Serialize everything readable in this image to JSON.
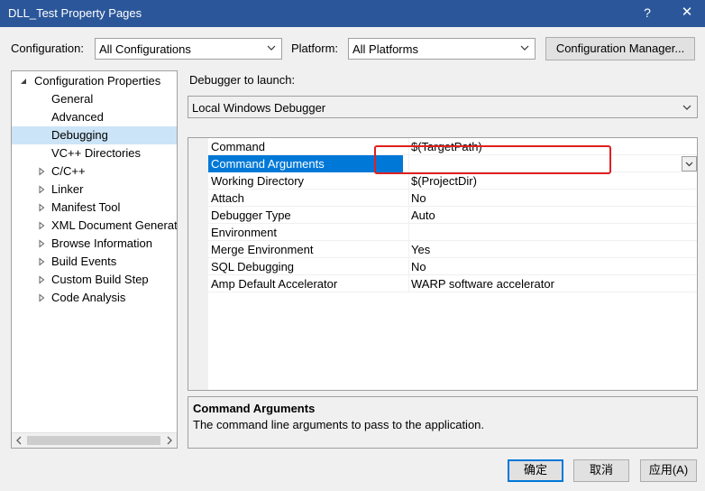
{
  "window": {
    "title": "DLL_Test Property Pages",
    "help": "?",
    "close": "✕"
  },
  "config": {
    "label": "Configuration:",
    "value": "All Configurations",
    "platform_label": "Platform:",
    "platform_value": "All Platforms",
    "manager_button": "Configuration Manager..."
  },
  "tree": {
    "items": [
      {
        "label": "Configuration Properties",
        "expander": "expanded"
      },
      {
        "label": "General",
        "expander": "none"
      },
      {
        "label": "Advanced",
        "expander": "none"
      },
      {
        "label": "Debugging",
        "expander": "none",
        "selected": true
      },
      {
        "label": "VC++ Directories",
        "expander": "none"
      },
      {
        "label": "C/C++",
        "expander": "collapsed"
      },
      {
        "label": "Linker",
        "expander": "collapsed"
      },
      {
        "label": "Manifest Tool",
        "expander": "collapsed"
      },
      {
        "label": "XML Document Generat",
        "expander": "collapsed"
      },
      {
        "label": "Browse Information",
        "expander": "collapsed"
      },
      {
        "label": "Build Events",
        "expander": "collapsed"
      },
      {
        "label": "Custom Build Step",
        "expander": "collapsed"
      },
      {
        "label": "Code Analysis",
        "expander": "collapsed"
      }
    ]
  },
  "debugger": {
    "label": "Debugger to launch:",
    "value": "Local Windows Debugger"
  },
  "properties": [
    {
      "name": "Command",
      "value": "$(TargetPath)"
    },
    {
      "name": "Command Arguments",
      "value": "",
      "selected": true
    },
    {
      "name": "Working Directory",
      "value": "$(ProjectDir)"
    },
    {
      "name": "Attach",
      "value": "No"
    },
    {
      "name": "Debugger Type",
      "value": "Auto"
    },
    {
      "name": "Environment",
      "value": ""
    },
    {
      "name": "Merge Environment",
      "value": "Yes"
    },
    {
      "name": "SQL Debugging",
      "value": "No"
    },
    {
      "name": "Amp Default Accelerator",
      "value": "WARP software accelerator"
    }
  ],
  "description": {
    "title": "Command Arguments",
    "text": "The command line arguments to pass to the application."
  },
  "buttons": {
    "ok": "确定",
    "cancel": "取消",
    "apply": "应用(A)"
  },
  "colors": {
    "titlebar": "#2b579a",
    "selection": "#0078d7",
    "tree_selection": "#cce4f7",
    "highlight_box": "#e02020"
  }
}
